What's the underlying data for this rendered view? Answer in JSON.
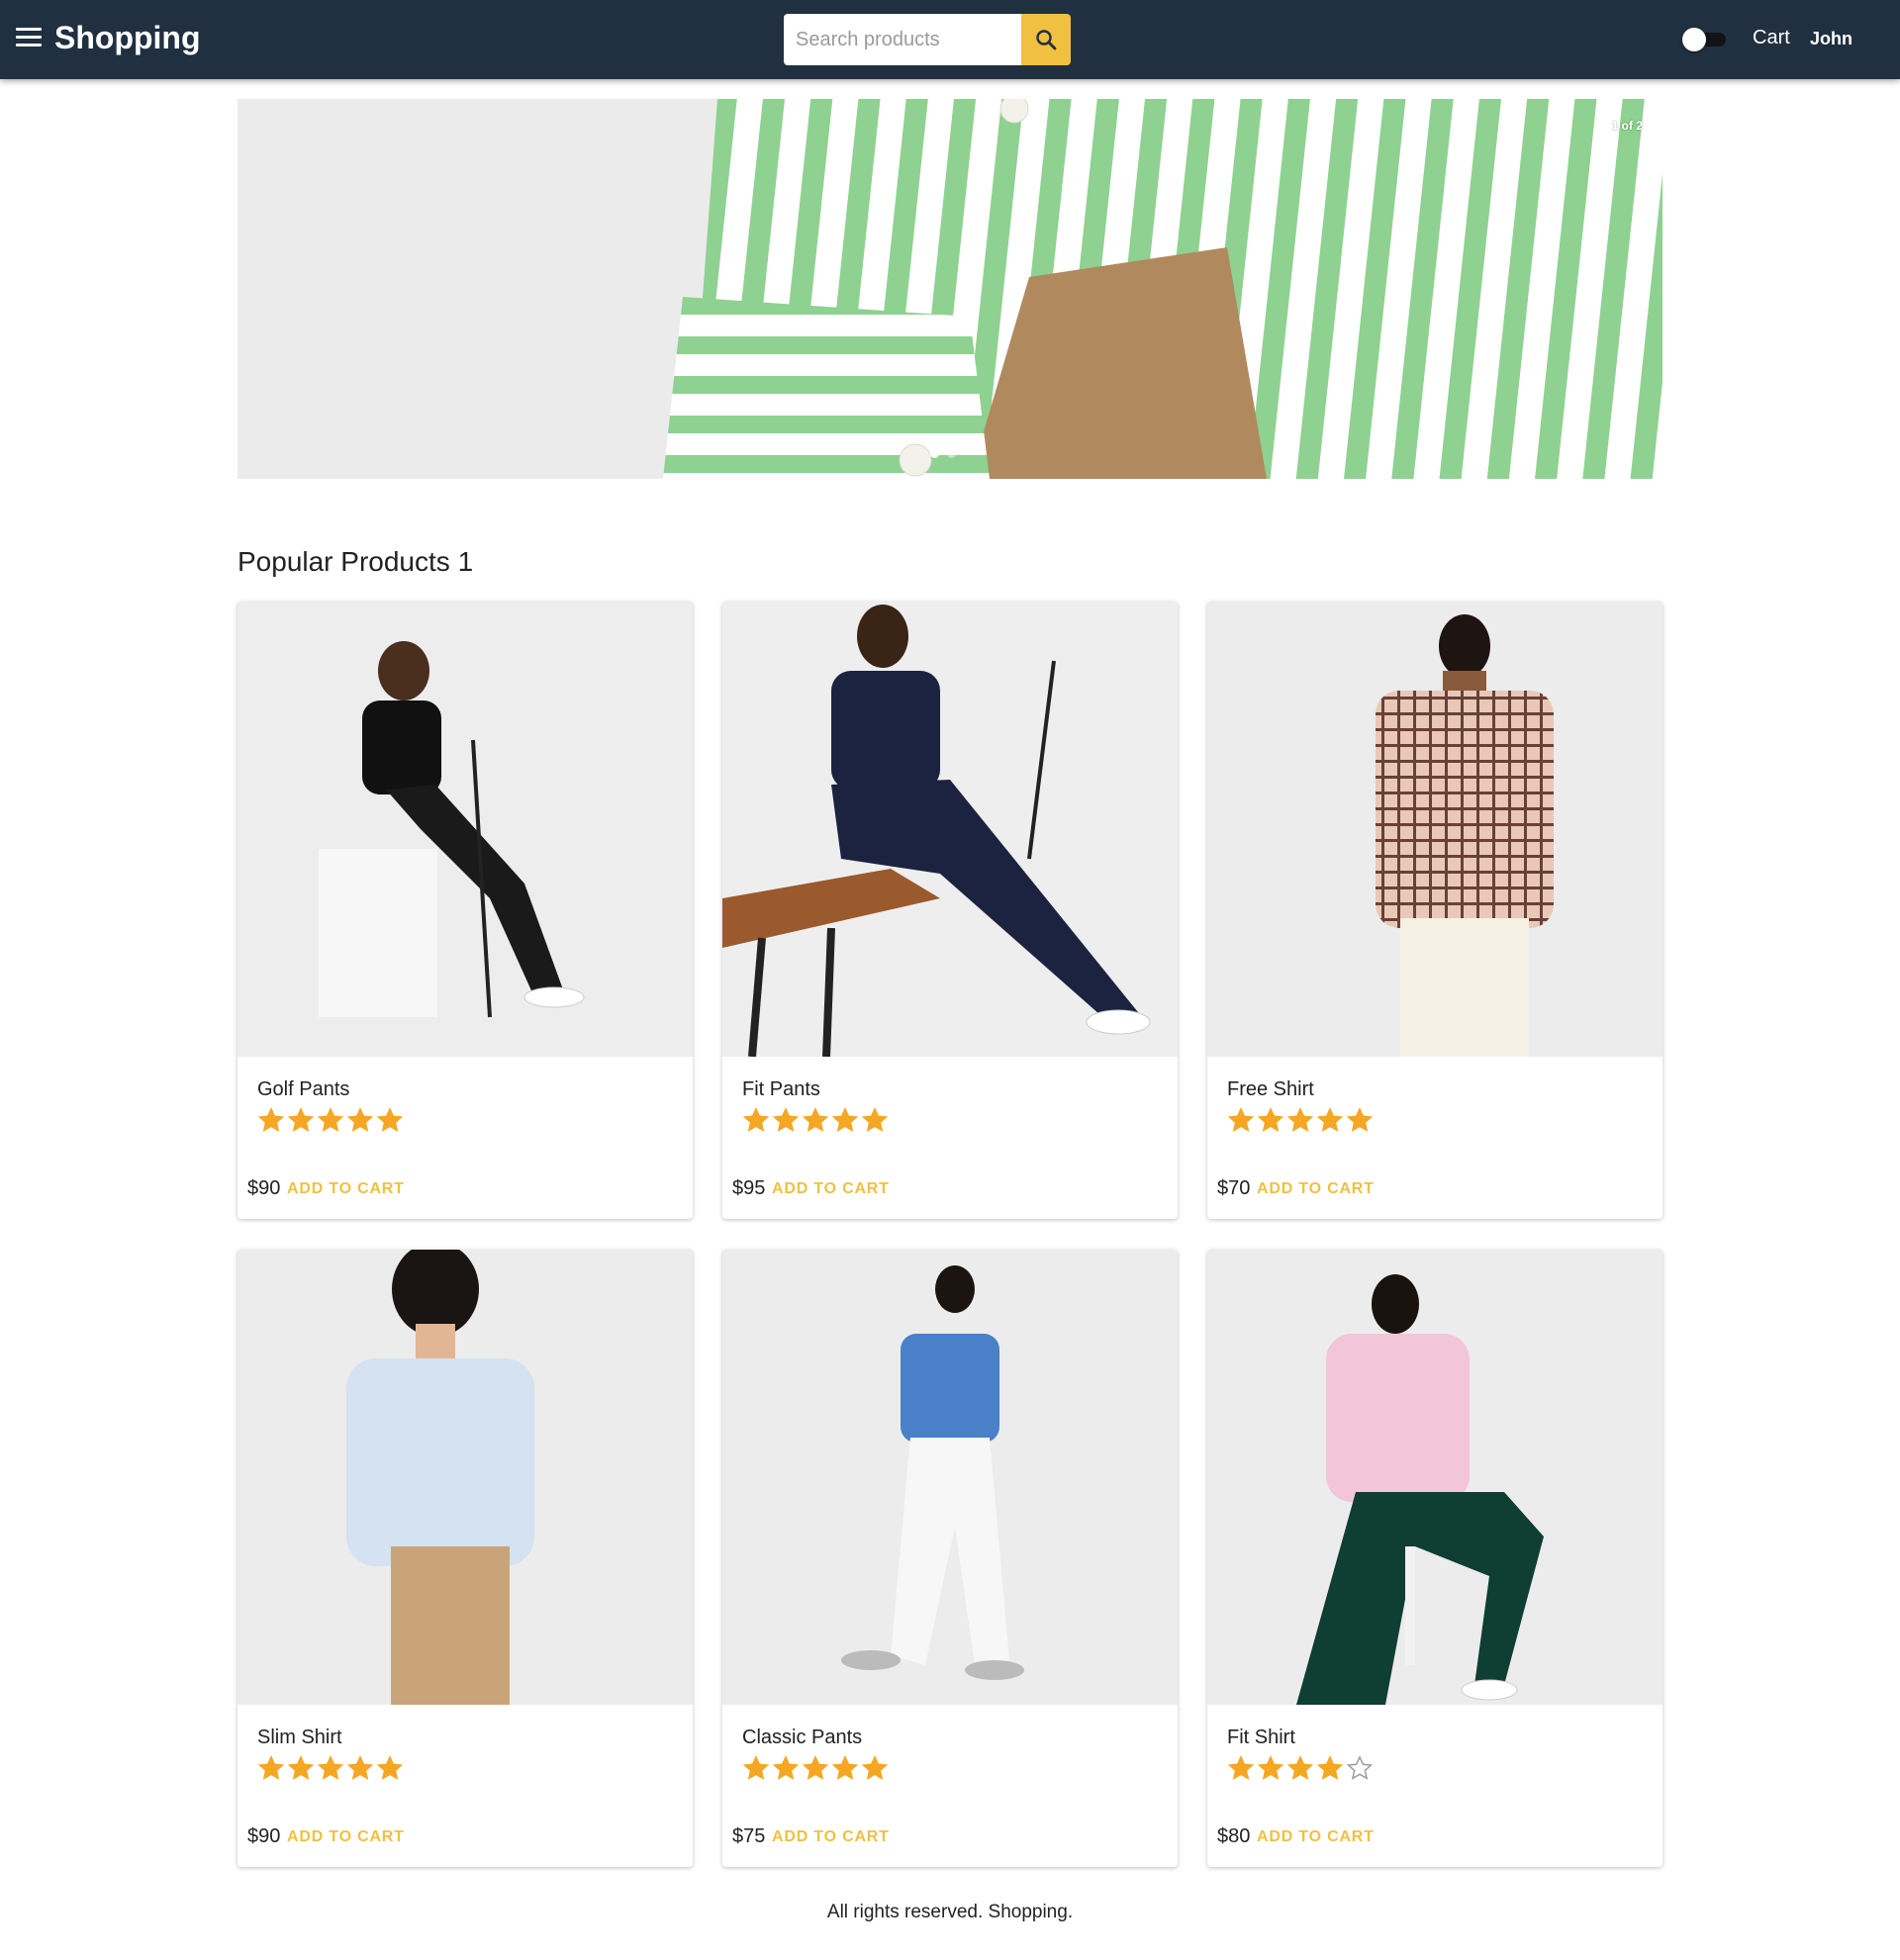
{
  "header": {
    "brand": "Shopping",
    "search_placeholder": "Search products",
    "search_value": "",
    "cart_label": "Cart",
    "user_name": "John",
    "accent_color": "#f0c040",
    "bar_color": "#203040",
    "menu_icon": "hamburger-icon",
    "search_icon": "search-icon",
    "theme_toggle": "off"
  },
  "carousel": {
    "counter": "1 of 2",
    "active_slide": 1,
    "slide_count": 2
  },
  "products": {
    "title": "Popular Products 1",
    "add_label": "ADD TO CART",
    "items": [
      {
        "name": "Golf Pants",
        "price": "$90",
        "rating": 5
      },
      {
        "name": "Fit Pants",
        "price": "$95",
        "rating": 5
      },
      {
        "name": "Free Shirt",
        "price": "$70",
        "rating": 5
      },
      {
        "name": "Slim Shirt",
        "price": "$90",
        "rating": 5
      },
      {
        "name": "Classic Pants",
        "price": "$75",
        "rating": 5
      },
      {
        "name": "Fit Shirt",
        "price": "$80",
        "rating": 4
      }
    ]
  },
  "footer": {
    "text": "All rights reserved. Shopping."
  }
}
